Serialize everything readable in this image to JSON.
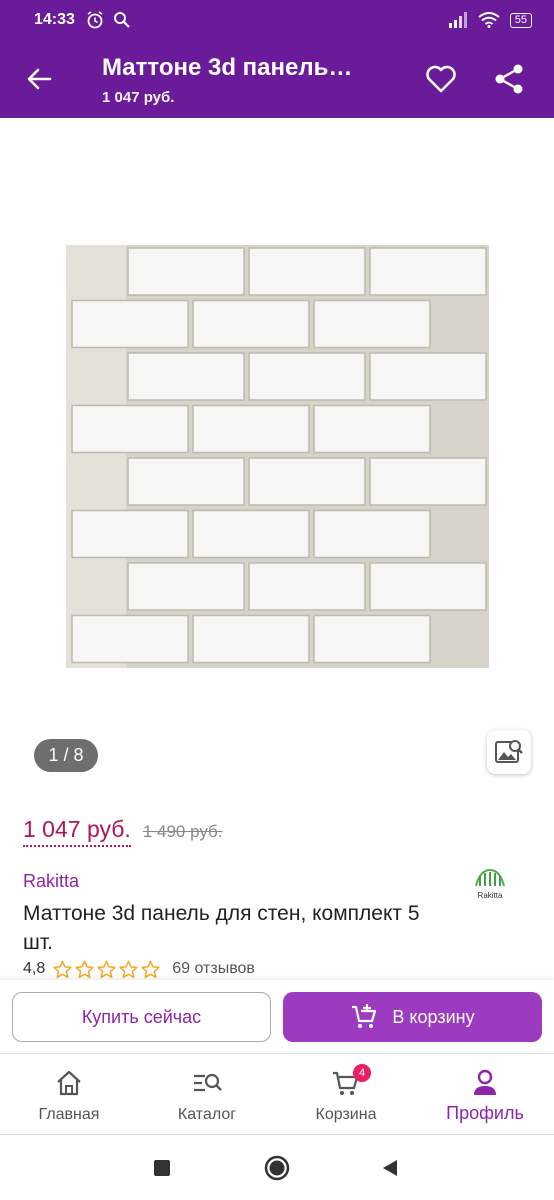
{
  "status_bar": {
    "time": "14:33",
    "battery": "55"
  },
  "app_bar": {
    "title": "Маттоне 3d панель…",
    "subtitle": "1 047 руб."
  },
  "gallery": {
    "counter": "1 / 8"
  },
  "price": {
    "current": "1 047 руб.",
    "old": "1 490 руб."
  },
  "product": {
    "brand": "Rakitta",
    "brand_logo_text": "Rakitta",
    "name": "Маттоне 3d панель для стен, комплект 5 шт.",
    "rating": "4,8",
    "rating_stars": 5,
    "reviews": "69 отзывов"
  },
  "actions": {
    "buy_now": "Купить сейчас",
    "add_to_cart": "В корзину"
  },
  "bottom_nav": {
    "items": [
      {
        "label": "Главная",
        "icon": "home-icon"
      },
      {
        "label": "Каталог",
        "icon": "catalog-search-icon"
      },
      {
        "label": "Корзина",
        "icon": "cart-icon",
        "badge": "4"
      },
      {
        "label": "Профиль",
        "icon": "profile-icon",
        "active": true
      }
    ]
  },
  "colors": {
    "brand_purple": "#6a1b9a",
    "accent": "#9c3bbf",
    "price": "#b0145a",
    "badge": "#e91e63"
  }
}
